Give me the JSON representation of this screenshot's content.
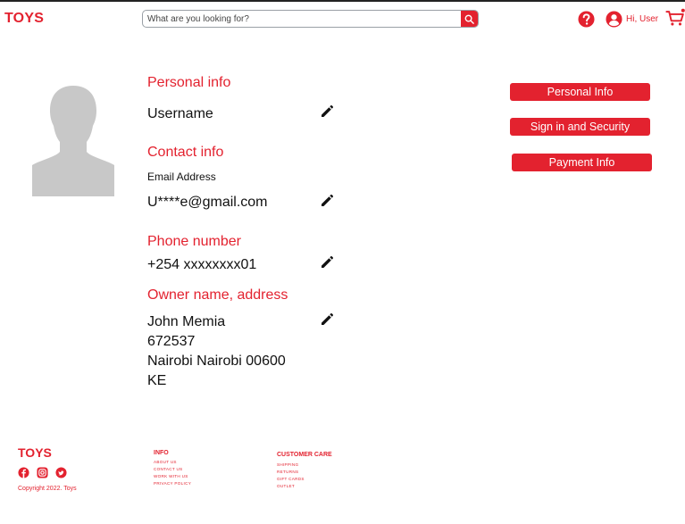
{
  "header": {
    "logo": "TOYS",
    "search_placeholder": "What are you looking for?",
    "greeting": "Hi, User"
  },
  "profile": {
    "personal_title": "Personal info",
    "username": "Username",
    "contact_title": "Contact info",
    "email_label": "Email Address",
    "email_value": "U****e@gmail.com",
    "phone_title": "Phone number",
    "phone_value": "+254 xxxxxxxx01",
    "owner_title": "Owner name, address",
    "address_lines": [
      "John Memia",
      "672537",
      "Nairobi Nairobi 00600",
      "KE"
    ]
  },
  "sidebar": {
    "buttons": [
      "Personal Info",
      "Sign in and Security",
      "Payment Info"
    ]
  },
  "footer": {
    "logo": "TOYS",
    "copyright": "Copyright 2022. Toys",
    "info_title": "INFO",
    "info_links": [
      "ABOUT US",
      "CONTACT US",
      "WORK WITH US",
      "PRIVACY POLICY"
    ],
    "care_title": "CUSTOMER CARE",
    "care_links": [
      "SHIPPING",
      "RETURNS",
      "GIFT CARDS",
      "OUTLET"
    ]
  },
  "colors": {
    "accent": "#e3222f",
    "avatar": "#c8c8c8"
  },
  "icons": [
    "search-icon",
    "help-icon",
    "user-icon",
    "cart-icon",
    "edit-icon",
    "facebook-icon",
    "instagram-icon",
    "twitter-icon"
  ]
}
